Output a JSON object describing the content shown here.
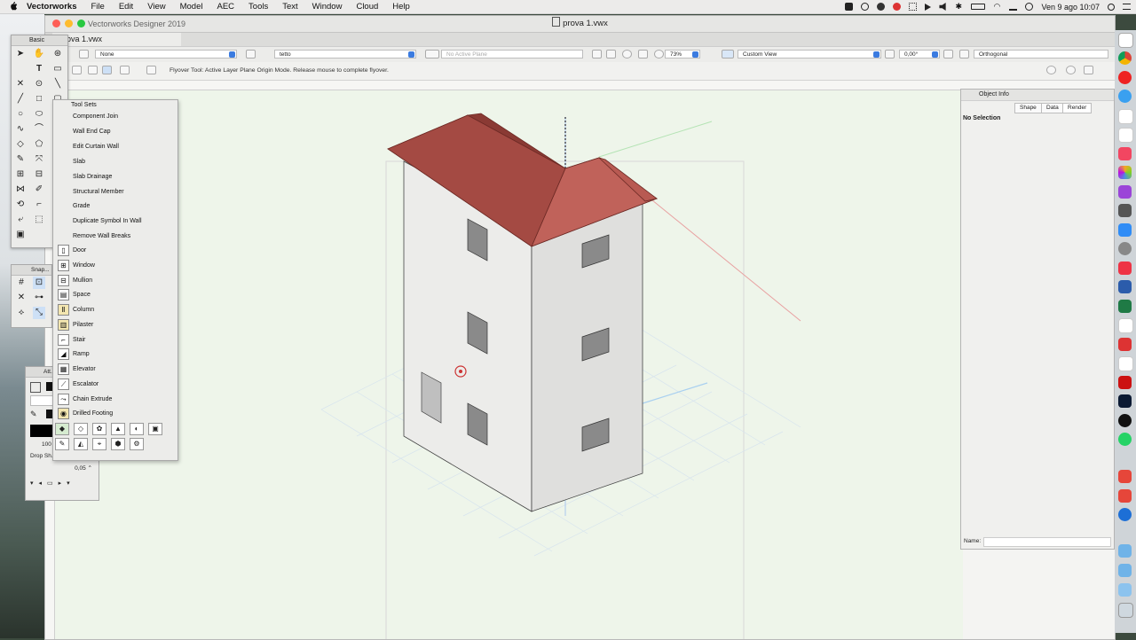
{
  "menubar": {
    "app": "Vectorworks",
    "items": [
      "File",
      "Edit",
      "View",
      "Model",
      "AEC",
      "Tools",
      "Text",
      "Window",
      "Cloud",
      "Help"
    ],
    "clock": "Ven 9 ago  10:07"
  },
  "window": {
    "title": "Vectorworks Designer 2019",
    "file_title": "prova 1.vwx",
    "doc_tab": "prova 1.vwx"
  },
  "view_bar": {
    "class": "None",
    "layer": "tetto",
    "plane": "No Active Plane",
    "zoom": "73%",
    "view": "Custom View",
    "angle": "0,00°",
    "projection": "Orthogonal"
  },
  "mode_bar": {
    "hint": "Flyover Tool: Active Layer Plane Origin Mode. Release mouse to complete flyover."
  },
  "basic_palette": {
    "title": "Basic"
  },
  "snap_palette": {
    "title": "Snap..."
  },
  "attributes_palette": {
    "title": "Att...",
    "opacity": "100",
    "line_weight": "0,05",
    "drop_shadow": "Drop Sh..."
  },
  "tool_sets": {
    "title": "Tool Sets",
    "items": [
      {
        "label": "Component Join",
        "icon": "component-join-icon"
      },
      {
        "label": "Wall End Cap",
        "icon": "wall-end-cap-icon"
      },
      {
        "label": "Edit Curtain Wall",
        "icon": "curtain-wall-icon"
      },
      {
        "label": "Slab",
        "icon": "slab-icon"
      },
      {
        "label": "Slab Drainage",
        "icon": "slab-drainage-icon"
      },
      {
        "label": "Structural Member",
        "icon": "structural-member-icon"
      },
      {
        "label": "Grade",
        "icon": "grade-icon"
      },
      {
        "label": "Duplicate Symbol In Wall",
        "icon": "duplicate-symbol-icon"
      },
      {
        "label": "Remove Wall Breaks",
        "icon": "remove-wall-breaks-icon"
      },
      {
        "label": "Door",
        "icon": "door-icon"
      },
      {
        "label": "Window",
        "icon": "window-icon"
      },
      {
        "label": "Mullion",
        "icon": "mullion-icon"
      },
      {
        "label": "Space",
        "icon": "space-icon"
      },
      {
        "label": "Column",
        "icon": "column-icon"
      },
      {
        "label": "Pilaster",
        "icon": "pilaster-icon"
      },
      {
        "label": "Stair",
        "icon": "stair-icon"
      },
      {
        "label": "Ramp",
        "icon": "ramp-icon"
      },
      {
        "label": "Elevator",
        "icon": "elevator-icon"
      },
      {
        "label": "Escalator",
        "icon": "escalator-icon"
      },
      {
        "label": "Chain Extrude",
        "icon": "chain-extrude-icon"
      },
      {
        "label": "Drilled Footing",
        "icon": "drilled-footing-icon"
      }
    ]
  },
  "object_info": {
    "title": "Object Info",
    "tabs": [
      "Shape",
      "Data",
      "Render"
    ],
    "selection": "No Selection",
    "name_label": "Name:"
  },
  "colors": {
    "roof": "#b0524a",
    "wall": "#ebebe9",
    "drawing_bg": "#eef5ea",
    "accent": "#3b7be0"
  }
}
